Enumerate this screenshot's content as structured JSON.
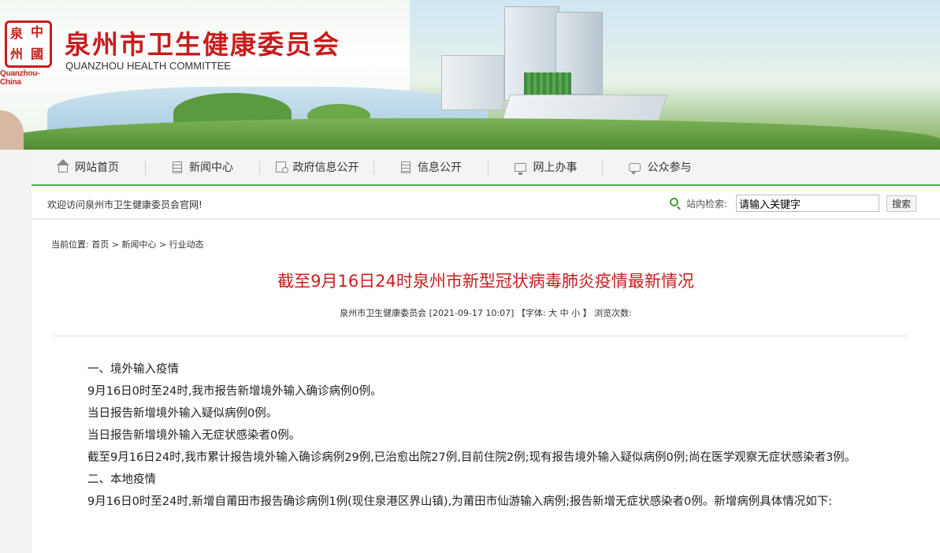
{
  "header": {
    "logo_caption": "Quanzhou-China",
    "logo_seal_chars": [
      "泉",
      "中",
      "州",
      "國"
    ],
    "site_title": "泉州市卫生健康委员会",
    "site_subtitle": "QUANZHOU HEALTH COMMITTEE"
  },
  "nav": {
    "items": [
      {
        "label": "网站首页",
        "icon": "home-icon"
      },
      {
        "label": "新闻中心",
        "icon": "document-icon"
      },
      {
        "label": "政府信息公开",
        "icon": "government-info-icon"
      },
      {
        "label": "信息公开",
        "icon": "document-icon"
      },
      {
        "label": "网上办事",
        "icon": "monitor-icon"
      },
      {
        "label": "公众参与",
        "icon": "chat-icon"
      }
    ],
    "accent_color": "#59b02c"
  },
  "welcome_bar": {
    "welcome_text": "欢迎访问泉州市卫生健康委员会官网!",
    "search_label": "站内检索:",
    "search_value": "请输入关键字",
    "search_button": "搜索"
  },
  "breadcrumb": {
    "prefix": "当前位置:",
    "items": [
      "首页",
      "新闻中心",
      "行业动态"
    ],
    "separator": ">"
  },
  "article": {
    "title": "截至9月16日24时泉州市新型冠状病毒肺炎疫情最新情况",
    "title_color": "#c81d1d",
    "meta": {
      "source": "泉州市卫生健康委员会",
      "datetime": "[2021-09-17 10:07]",
      "font_prefix": "【字体:",
      "font_large": "大",
      "font_medium": "中",
      "font_small": "小",
      "font_suffix": "】",
      "views_label": "浏览次数:"
    },
    "paragraphs": [
      "一、境外输入疫情",
      "9月16日0时至24时,我市报告新增境外输入确诊病例0例。",
      "当日报告新增境外输入疑似病例0例。",
      "当日报告新增境外输入无症状感染者0例。",
      "截至9月16日24时,我市累计报告境外输入确诊病例29例,已治愈出院27例,目前住院2例;现有报告境外输入疑似病例0例;尚在医学观察无症状感染者3例。",
      "二、本地疫情",
      "9月16日0时至24时,新增自莆田市报告确诊病例1例(现住泉港区界山镇),为莆田市仙游输入病例;报告新增无症状感染者0例。新增病例具体情况如下:"
    ]
  }
}
